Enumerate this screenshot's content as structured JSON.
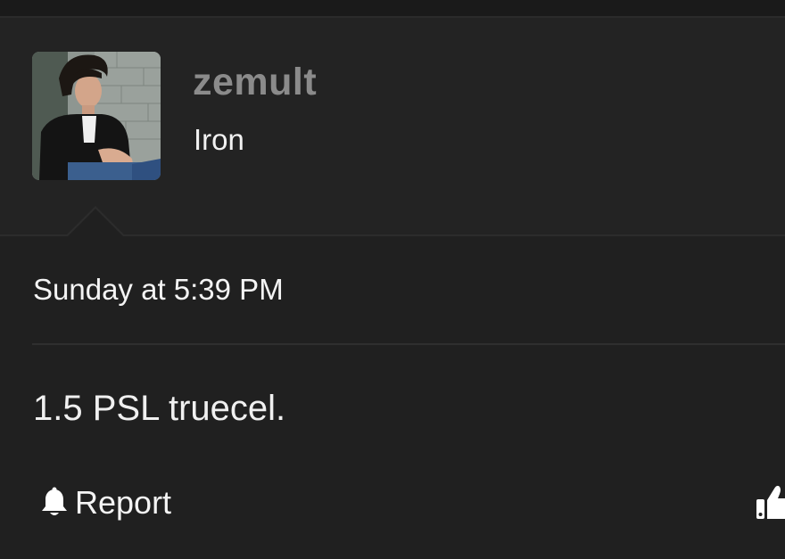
{
  "post": {
    "user": {
      "name": "zemult",
      "title": "Iron"
    },
    "timestamp": "Sunday at 5:39 PM",
    "message": "1.5 PSL truecel.",
    "actions": {
      "report_label": "Report"
    }
  },
  "icons": {
    "report": "bell-icon",
    "like": "thumbs-up-icon"
  },
  "colors": {
    "background": "#202020",
    "header_background": "#232323",
    "username": "#8b8b8b",
    "text": "#f4f4f4"
  }
}
